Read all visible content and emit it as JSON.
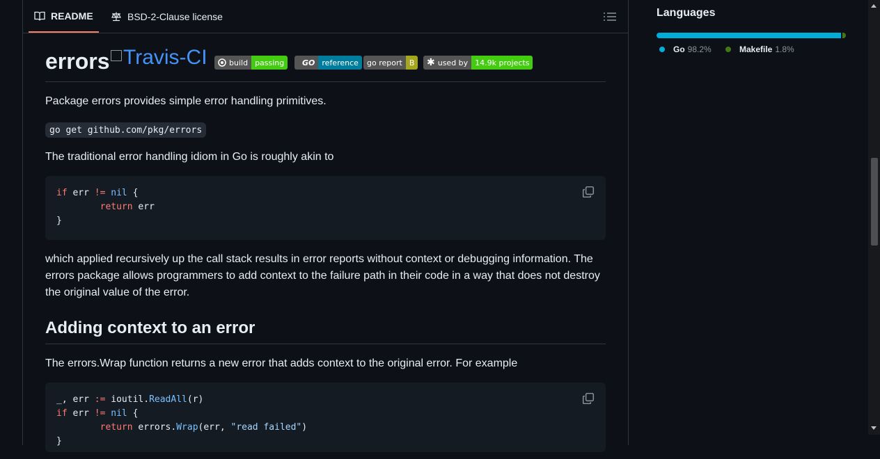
{
  "tabs": {
    "readme": "README",
    "license": "BSD-2-Clause license"
  },
  "heading": {
    "title": "errors",
    "travis_alt": "Travis-CI"
  },
  "badges": [
    {
      "left": "build",
      "right": "passing",
      "right_color": "#4c1"
    },
    {
      "left": "GO",
      "right": "reference",
      "right_color": "#007d9c"
    },
    {
      "left": "go report",
      "right": "B",
      "right_color": "#a4a61d"
    },
    {
      "left": "used by",
      "right": "14.9k projects",
      "right_color": "#4c1"
    }
  ],
  "content": {
    "intro": "Package errors provides simple error handling primitives.",
    "install_cmd": "go get github.com/pkg/errors",
    "idiom": "The traditional error handling idiom in Go is roughly akin to",
    "explain": "which applied recursively up the call stack results in error reports without context or debugging information. The errors package allows programmers to add context to the failure path in their code in a way that does not destroy the original value of the error.",
    "section_title": "Adding context to an error",
    "wrap_desc": "The errors.Wrap function returns a new error that adds context to the original error. For example"
  },
  "languages": {
    "title": "Languages",
    "items": [
      {
        "name": "Go",
        "percent": "98.2%",
        "value": 98.2,
        "color": "#00add8"
      },
      {
        "name": "Makefile",
        "percent": "1.8%",
        "value": 1.8,
        "color": "#427819"
      }
    ]
  }
}
